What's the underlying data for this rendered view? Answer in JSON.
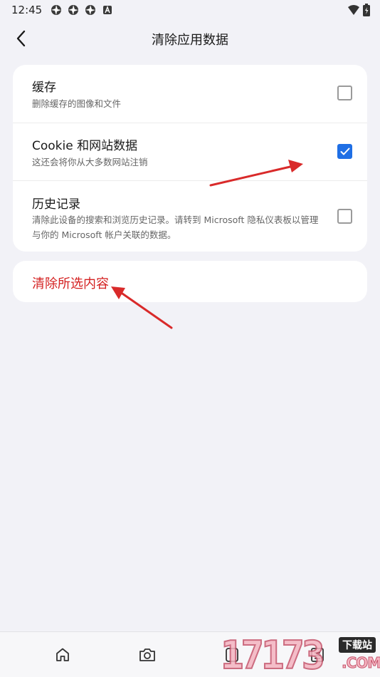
{
  "status_bar": {
    "time": "12:45",
    "icons": [
      "aperture-icon",
      "aperture-icon",
      "aperture-icon",
      "a-badge-icon"
    ],
    "right_icons": [
      "wifi-icon",
      "battery-icon"
    ]
  },
  "header": {
    "title": "清除应用数据",
    "back_icon": "chevron-left-icon"
  },
  "options": [
    {
      "title": "缓存",
      "description": "删除缓存的图像和文件",
      "checked": false
    },
    {
      "title": "Cookie 和网站数据",
      "description": "这还会将你从大多数网站注销",
      "checked": true
    },
    {
      "title": "历史记录",
      "description": "清除此设备的搜索和浏览历史记录。请转到 Microsoft 隐私仪表板以管理与你的 Microsoft 帐户关联的数据。",
      "checked": false
    }
  ],
  "clear_button": {
    "label": "清除所选内容"
  },
  "bottom_nav": {
    "items": [
      "home-icon",
      "camera-icon",
      "tabs-icon",
      "menu-icon"
    ],
    "tab_count": "0"
  },
  "watermark": {
    "digits": "17173",
    "tag": "下载站",
    "suffix": ".COM"
  },
  "colors": {
    "accent": "#1f6fe5",
    "danger": "#d42121",
    "arrow": "#d92a2a",
    "background": "#f2f2f7"
  }
}
